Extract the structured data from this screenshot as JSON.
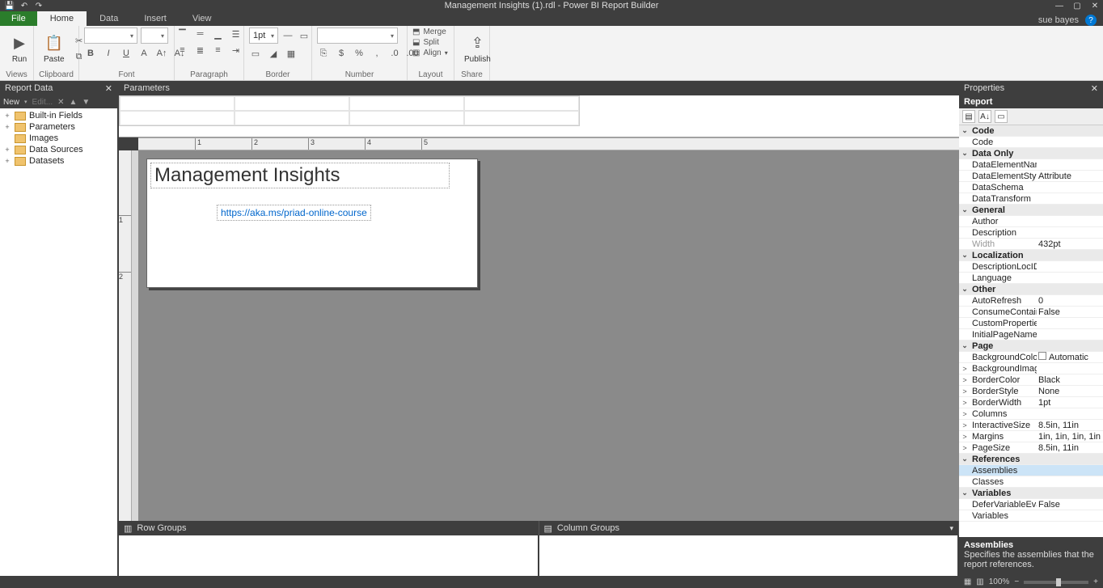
{
  "title": "Management Insights (1).rdl - Power BI Report Builder",
  "user": "sue bayes",
  "tabs": {
    "file": "File",
    "home": "Home",
    "data": "Data",
    "insert": "Insert",
    "view": "View"
  },
  "ribbon": {
    "views": {
      "run": "Run",
      "label": "Views"
    },
    "clipboard": {
      "paste": "Paste",
      "label": "Clipboard"
    },
    "font": {
      "label": "Font",
      "family": "",
      "size": ""
    },
    "paragraph": {
      "label": "Paragraph"
    },
    "border": {
      "label": "Border",
      "width": "1pt"
    },
    "number": {
      "label": "Number",
      "format": ""
    },
    "layout": {
      "label": "Layout",
      "merge": "Merge",
      "split": "Split",
      "align": "Align"
    },
    "share": {
      "label": "Share",
      "publish": "Publish"
    }
  },
  "report_data": {
    "title": "Report Data",
    "newbtn": "New",
    "editbtn": "Edit...",
    "items": [
      "Built-in Fields",
      "Parameters",
      "Images",
      "Data Sources",
      "Datasets"
    ]
  },
  "parameters_title": "Parameters",
  "design": {
    "report_title": "Management Insights",
    "link_text": "https://aka.ms/priad-online-course"
  },
  "groups": {
    "row": "Row Groups",
    "col": "Column Groups"
  },
  "properties": {
    "title": "Properties",
    "object": "Report",
    "cats": [
      {
        "name": "Code",
        "rows": [
          {
            "k": "Code",
            "v": ""
          }
        ]
      },
      {
        "name": "Data Only",
        "rows": [
          {
            "k": "DataElementName",
            "v": ""
          },
          {
            "k": "DataElementStyle",
            "v": "Attribute"
          },
          {
            "k": "DataSchema",
            "v": ""
          },
          {
            "k": "DataTransform",
            "v": ""
          }
        ]
      },
      {
        "name": "General",
        "rows": [
          {
            "k": "Author",
            "v": ""
          },
          {
            "k": "Description",
            "v": ""
          },
          {
            "k": "Width",
            "v": "432pt",
            "dim": true
          }
        ]
      },
      {
        "name": "Localization",
        "rows": [
          {
            "k": "DescriptionLocID",
            "v": ""
          },
          {
            "k": "Language",
            "v": ""
          }
        ]
      },
      {
        "name": "Other",
        "rows": [
          {
            "k": "AutoRefresh",
            "v": "0"
          },
          {
            "k": "ConsumeContainerWhitespace",
            "v": "False"
          },
          {
            "k": "CustomProperties",
            "v": ""
          },
          {
            "k": "InitialPageName",
            "v": ""
          }
        ]
      },
      {
        "name": "Page",
        "rows": [
          {
            "k": "BackgroundColor",
            "v": "Automatic",
            "swatch": true
          },
          {
            "k": "BackgroundImage",
            "v": "",
            "exp": ">"
          },
          {
            "k": "BorderColor",
            "v": "Black",
            "exp": ">"
          },
          {
            "k": "BorderStyle",
            "v": "None",
            "exp": ">"
          },
          {
            "k": "BorderWidth",
            "v": "1pt",
            "exp": ">"
          },
          {
            "k": "Columns",
            "v": "",
            "exp": ">"
          },
          {
            "k": "InteractiveSize",
            "v": "8.5in, 11in",
            "exp": ">"
          },
          {
            "k": "Margins",
            "v": "1in, 1in, 1in, 1in",
            "exp": ">"
          },
          {
            "k": "PageSize",
            "v": "8.5in, 11in",
            "exp": ">"
          }
        ]
      },
      {
        "name": "References",
        "rows": [
          {
            "k": "Assemblies",
            "v": "",
            "sel": true
          },
          {
            "k": "Classes",
            "v": ""
          }
        ]
      },
      {
        "name": "Variables",
        "rows": [
          {
            "k": "DeferVariableEvaluation",
            "v": "False"
          },
          {
            "k": "Variables",
            "v": ""
          }
        ]
      }
    ],
    "desc_title": "Assemblies",
    "desc_text": "Specifies the assemblies that the report references."
  },
  "status": {
    "zoom": "100%"
  }
}
